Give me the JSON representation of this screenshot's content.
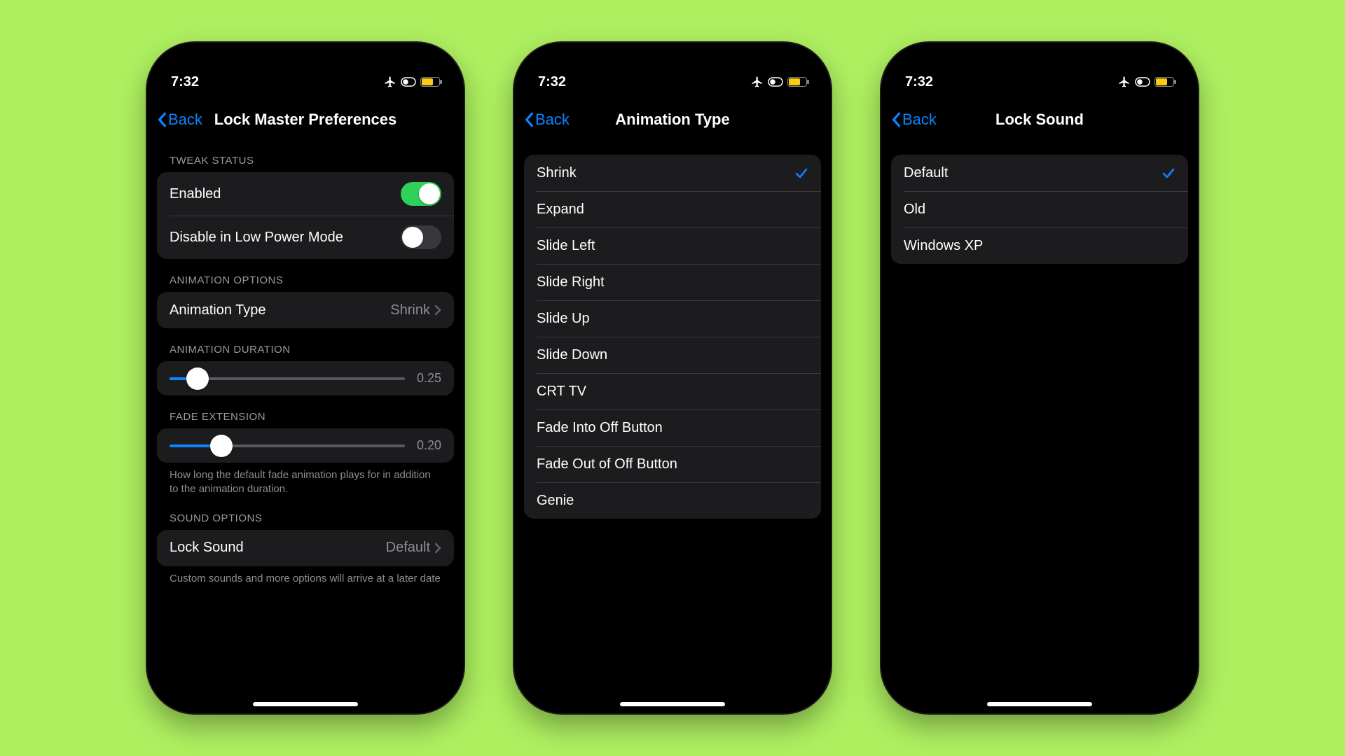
{
  "status": {
    "time": "7:32",
    "battery_color": "#facc15"
  },
  "nav": {
    "back": "Back"
  },
  "phone1": {
    "title": "Lock Master Preferences",
    "tweak_header": "TWEAK STATUS",
    "enabled_label": "Enabled",
    "enabled": true,
    "lowpower_label": "Disable in Low Power Mode",
    "lowpower": false,
    "anim_header": "ANIMATION OPTIONS",
    "anim_type_label": "Animation Type",
    "anim_type_value": "Shrink",
    "duration_header": "ANIMATION DURATION",
    "duration_value": "0.25",
    "duration_fill_pct": 12,
    "fade_header": "FADE EXTENSION",
    "fade_value": "0.20",
    "fade_fill_pct": 22,
    "fade_footer": "How long the default fade animation plays for in addition to the animation duration.",
    "sound_header": "SOUND OPTIONS",
    "lock_sound_label": "Lock Sound",
    "lock_sound_value": "Default",
    "sound_footer": "Custom sounds and more options will arrive at a later date"
  },
  "phone2": {
    "title": "Animation Type",
    "selected": "Shrink",
    "options": [
      "Shrink",
      "Expand",
      "Slide Left",
      "Slide Right",
      "Slide Up",
      "Slide Down",
      "CRT TV",
      "Fade Into Off Button",
      "Fade Out of Off Button",
      "Genie"
    ]
  },
  "phone3": {
    "title": "Lock Sound",
    "selected": "Default",
    "options": [
      "Default",
      "Old",
      "Windows XP"
    ]
  }
}
